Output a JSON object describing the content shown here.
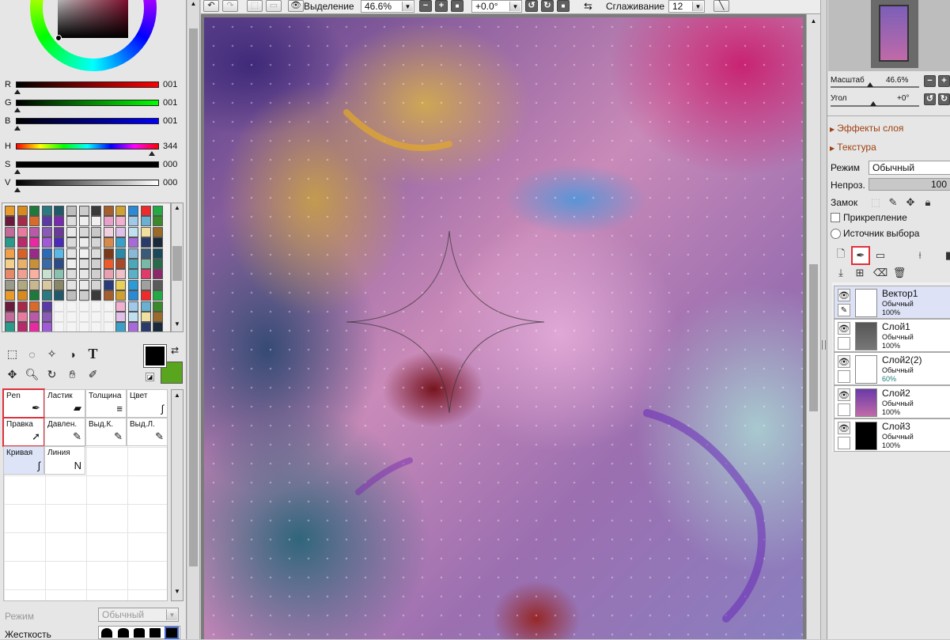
{
  "colors": {
    "accent_red": "#e0303a",
    "fg_color": "#000000",
    "bg_color": "#5aa51e"
  },
  "toolbar": {
    "selection_label": "Выделение",
    "zoom_value": "46.6%",
    "zoom_minus": "−",
    "zoom_plus": "+",
    "zoom_reset": "■",
    "rotation_value": "+0.0°",
    "smoothing_label": "Сглаживание",
    "smoothing_value": "12"
  },
  "color_sliders": [
    {
      "letter": "R",
      "value": "001"
    },
    {
      "letter": "G",
      "value": "001"
    },
    {
      "letter": "B",
      "value": "001"
    },
    {
      "letter": "H",
      "value": "344"
    },
    {
      "letter": "S",
      "value": "000"
    },
    {
      "letter": "V",
      "value": "000"
    }
  ],
  "tool_cells": [
    {
      "label": "Pen",
      "icon": "pen-icon",
      "glyph": "✒"
    },
    {
      "label": "Ластик",
      "icon": "eraser-icon",
      "glyph": "▰"
    },
    {
      "label": "Толщина",
      "icon": "thickness-icon",
      "glyph": "≡"
    },
    {
      "label": "Цвет",
      "icon": "color-icon",
      "glyph": "∫"
    },
    {
      "label": "Правка",
      "icon": "edit-cursor-icon",
      "glyph": "➚"
    },
    {
      "label": "Давлен.",
      "icon": "pressure-icon",
      "glyph": "✎"
    },
    {
      "label": "Выд.К.",
      "icon": "select-curve-icon",
      "glyph": "✎"
    },
    {
      "label": "Выд.Л.",
      "icon": "select-layer-icon",
      "glyph": "✎"
    },
    {
      "label": "Кривая",
      "icon": "curve-icon",
      "glyph": "∫"
    },
    {
      "label": "Линия",
      "icon": "line-icon",
      "glyph": "N"
    }
  ],
  "brush_settings": {
    "mode_label": "Режим",
    "mode_value": "Обычный",
    "hardness_label": "Жесткость"
  },
  "navigator": {
    "scale_label": "Масштаб",
    "scale_value": "46.6%",
    "angle_label": "Угол",
    "angle_value": "+0°"
  },
  "layer_panel": {
    "effects_label": "Эффекты слоя",
    "texture_label": "Текстура",
    "mode_label": "Режим",
    "mode_value": "Обычный",
    "opacity_label": "Непроз.",
    "opacity_value": "100",
    "lock_label": "Замок",
    "clipping_label": "Прикрепление",
    "selection_source_label": "Источник выбора"
  },
  "layers": [
    {
      "name": "Вектор1",
      "mode": "Обычный",
      "opacity": "100%",
      "selected": true
    },
    {
      "name": "Слой1",
      "mode": "Обычный",
      "opacity": "100%",
      "selected": false
    },
    {
      "name": "Слой2(2)",
      "mode": "Обычный",
      "opacity": "60%",
      "selected": false
    },
    {
      "name": "Слой2",
      "mode": "Обычный",
      "opacity": "100%",
      "selected": false
    },
    {
      "name": "Слой3",
      "mode": "Обычный",
      "opacity": "100%",
      "selected": false
    }
  ]
}
